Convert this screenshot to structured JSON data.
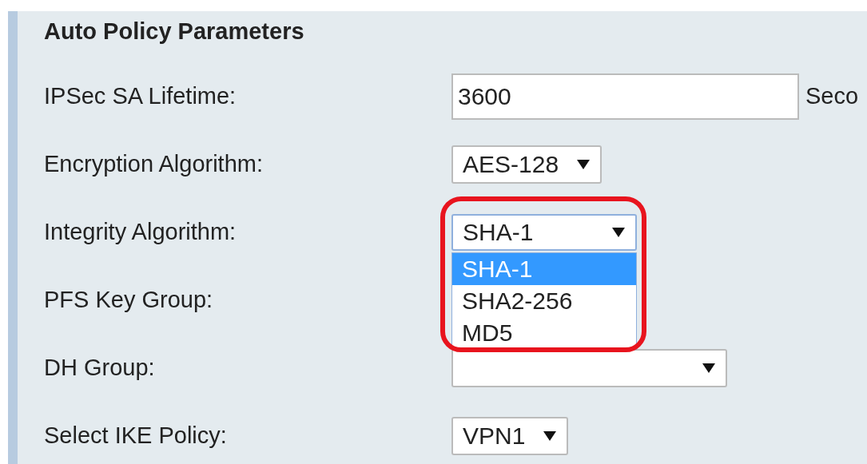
{
  "section": {
    "title": "Auto Policy Parameters"
  },
  "fields": [
    {
      "label": "IPSec SA Lifetime:",
      "kind": "text",
      "value": "3600",
      "suffix": "Seco"
    },
    {
      "label": "Encryption Algorithm:",
      "kind": "select",
      "value": "AES-128",
      "expanded": false
    },
    {
      "label": "Integrity Algorithm:",
      "kind": "select",
      "value": "SHA-1",
      "expanded": true,
      "highlighted": true,
      "options": [
        {
          "label": "SHA-1",
          "selected": true
        },
        {
          "label": "SHA2-256",
          "selected": false
        },
        {
          "label": "MD5",
          "selected": false
        }
      ]
    },
    {
      "label": "PFS Key Group:",
      "kind": "covered"
    },
    {
      "label": "DH Group:",
      "kind": "select",
      "expanded": false
    },
    {
      "label": "Select IKE Policy:",
      "kind": "select",
      "value": "VPN1",
      "expanded": false
    }
  ]
}
